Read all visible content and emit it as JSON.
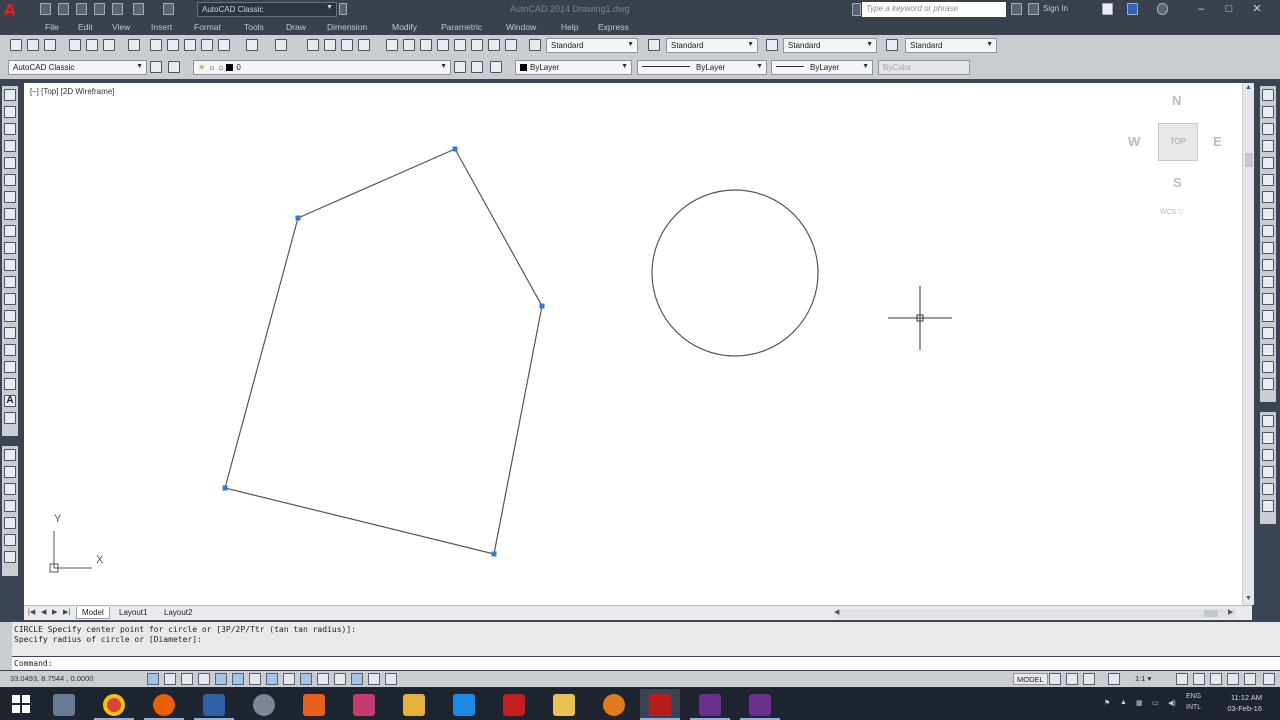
{
  "app": {
    "logo": "A",
    "title": "AutoCAD 2014    Drawing1.dwg",
    "workspace": "AutoCAD Classic",
    "search_placeholder": "Type a keyword or phrase",
    "sign_in": "Sign In"
  },
  "window_controls": [
    "–",
    "□",
    "✕"
  ],
  "menu": [
    "File",
    "Edit",
    "View",
    "Insert",
    "Format",
    "Tools",
    "Draw",
    "Dimension",
    "Modify",
    "Parametric",
    "Window",
    "Help",
    "Express"
  ],
  "styles": {
    "text_style": "Standard",
    "dim_style": "Standard",
    "table_style": "Standard",
    "multileader_style": "Standard"
  },
  "layers_toolbar": {
    "workspace": "AutoCAD Classic",
    "current_layer": "0",
    "color": "ByLayer",
    "linetype": "ByLayer",
    "lineweight": "ByLayer",
    "plot_style": "ByColor"
  },
  "viewport": {
    "label": "[–] [Top] [2D Wireframe]",
    "ucs_x": "X",
    "ucs_y": "Y"
  },
  "viewcube": {
    "north": "N",
    "south": "S",
    "east": "E",
    "west": "W",
    "face": "TOP",
    "wcs": "WCS ▽"
  },
  "layout_tabs": [
    "Model",
    "Layout1",
    "Layout2"
  ],
  "command": {
    "history": [
      "CIRCLE Specify center point for circle or [3P/2P/Ttr (tan tan radius)]:",
      "Specify radius of circle or [Diameter]:"
    ],
    "prompt": "Command:"
  },
  "status": {
    "coordinates": "33.0493, 8.7544 , 0.0000",
    "model": "MODEL",
    "scale": "1:1 ▾"
  },
  "taskbar": {
    "apps": [
      "file-explorer",
      "chrome",
      "firefox",
      "calculator",
      "network",
      "office",
      "paint",
      "folder",
      "azure",
      "acrobat",
      "explorer",
      "media-player",
      "autocad",
      "teams",
      "teams2"
    ],
    "language": "ENG",
    "language_sub": "INTL",
    "time": "11:12 AM",
    "date": "03-Feb-16"
  },
  "colors": {
    "accent": "#1e6fd0",
    "grip": "#2a7fd4",
    "drawing_line": "#555555",
    "dark_ui": "#39414d"
  }
}
